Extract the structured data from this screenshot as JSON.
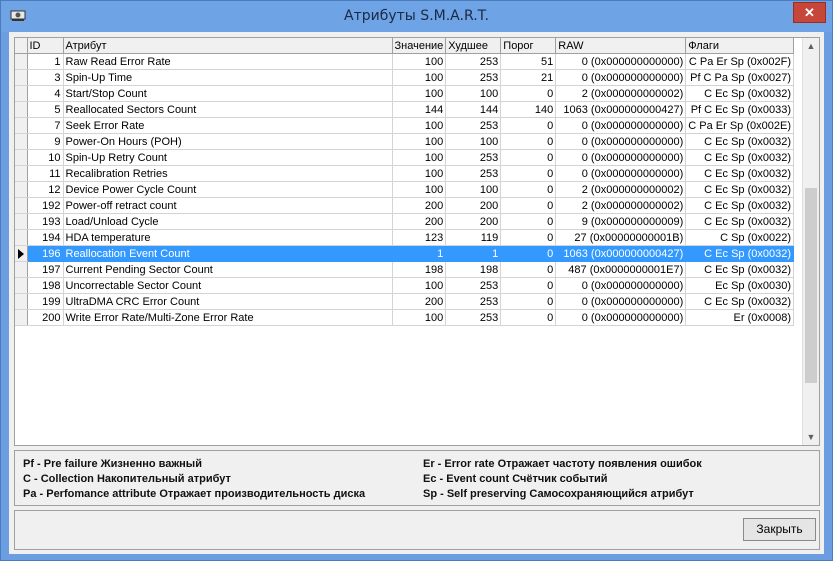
{
  "window": {
    "title": "Атрибуты S.M.A.R.T.",
    "close_glyph": "✕"
  },
  "table": {
    "columns": [
      "ID",
      "Атрибут",
      "Значение",
      "Худшее",
      "Порог",
      "RAW",
      "Флаги"
    ],
    "selected_index": 12,
    "rows": [
      [
        "1",
        "Raw Read Error Rate",
        "100",
        "253",
        "51",
        "0 (0x000000000000)",
        "C Pa Er Sp  (0x002F)"
      ],
      [
        "3",
        "Spin-Up Time",
        "100",
        "253",
        "21",
        "0 (0x000000000000)",
        "Pf C Pa Sp  (0x0027)"
      ],
      [
        "4",
        "Start/Stop Count",
        "100",
        "100",
        "0",
        "2 (0x000000000002)",
        "C Ec Sp  (0x0032)"
      ],
      [
        "5",
        "Reallocated Sectors Count",
        "144",
        "144",
        "140",
        "1063 (0x000000000427)",
        "Pf C Ec Sp  (0x0033)"
      ],
      [
        "7",
        "Seek Error Rate",
        "100",
        "253",
        "0",
        "0 (0x000000000000)",
        "C Pa Er Sp  (0x002E)"
      ],
      [
        "9",
        "Power-On Hours (POH)",
        "100",
        "100",
        "0",
        "0 (0x000000000000)",
        "C Ec Sp  (0x0032)"
      ],
      [
        "10",
        "Spin-Up Retry Count",
        "100",
        "253",
        "0",
        "0 (0x000000000000)",
        "C Ec Sp  (0x0032)"
      ],
      [
        "11",
        "Recalibration Retries",
        "100",
        "253",
        "0",
        "0 (0x000000000000)",
        "C Ec Sp  (0x0032)"
      ],
      [
        "12",
        "Device Power Cycle Count",
        "100",
        "100",
        "0",
        "2 (0x000000000002)",
        "C Ec Sp  (0x0032)"
      ],
      [
        "192",
        "Power-off retract count",
        "200",
        "200",
        "0",
        "2 (0x000000000002)",
        "C Ec Sp  (0x0032)"
      ],
      [
        "193",
        "Load/Unload Cycle",
        "200",
        "200",
        "0",
        "9 (0x000000000009)",
        "C Ec Sp  (0x0032)"
      ],
      [
        "194",
        "HDA temperature",
        "123",
        "119",
        "0",
        "27 (0x00000000001B)",
        "C Sp  (0x0022)"
      ],
      [
        "196",
        "Reallocation Event Count",
        "1",
        "1",
        "0",
        "1063 (0x000000000427)",
        "C Ec Sp  (0x0032)"
      ],
      [
        "197",
        "Current Pending Sector Count",
        "198",
        "198",
        "0",
        "487 (0x0000000001E7)",
        "C Ec Sp  (0x0032)"
      ],
      [
        "198",
        "Uncorrectable Sector Count",
        "100",
        "253",
        "0",
        "0 (0x000000000000)",
        "Ec Sp  (0x0030)"
      ],
      [
        "199",
        "UltraDMA CRC Error Count",
        "200",
        "253",
        "0",
        "0 (0x000000000000)",
        "C Ec Sp  (0x0032)"
      ],
      [
        "200",
        "Write Error Rate/Multi-Zone Error Rate",
        "100",
        "253",
        "0",
        "0 (0x000000000000)",
        "Er  (0x0008)"
      ]
    ]
  },
  "legend": {
    "pf": "Pf - Pre failure Жизненно важный",
    "c": "C - Collection Накопительный атрибут",
    "pa": "Pa - Perfomance attribute Отражает производительность диска",
    "er": "Er - Error rate Отражает частоту появления ошибок",
    "ec": "Ec - Event count Счётчик событий",
    "sp": "Sp - Self preserving Самосохраняющийся атрибут"
  },
  "buttons": {
    "close": "Закрыть"
  },
  "icons": {
    "scroll_up": "▲",
    "scroll_down": "▼"
  }
}
